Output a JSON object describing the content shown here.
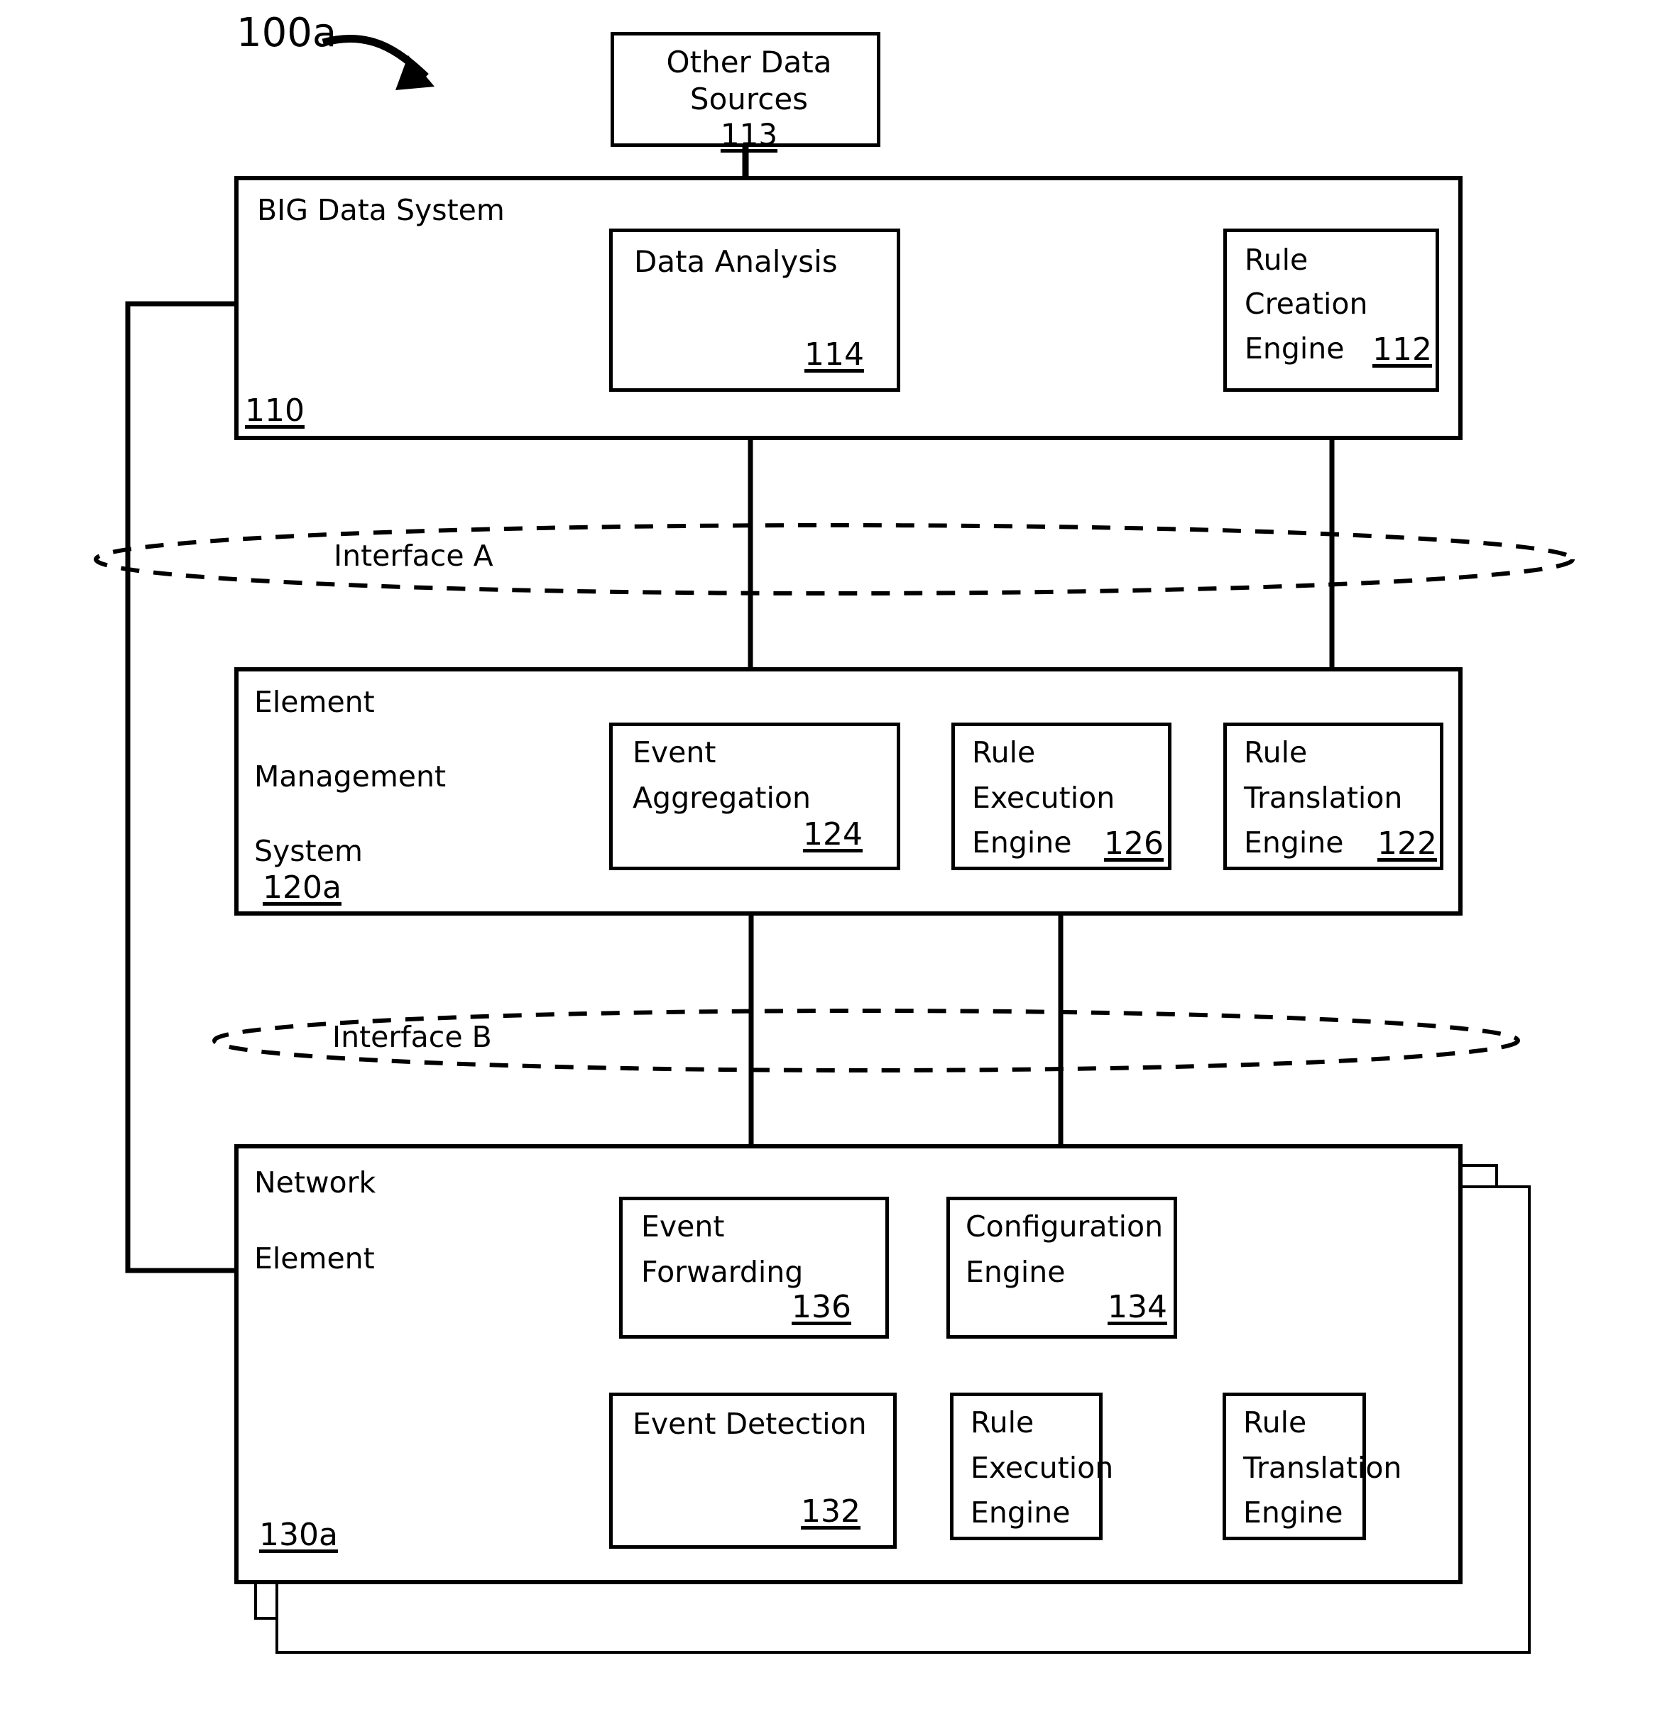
{
  "figure": {
    "id": "100a",
    "title_callout": "100a"
  },
  "nodes": {
    "other_data_sources": {
      "line1": "Other Data",
      "line2": "Sources",
      "ref": "113"
    },
    "big_data_system": {
      "label": "BIG Data System",
      "ref": "110"
    },
    "data_analysis": {
      "line1": "Data Analysis",
      "ref": "114"
    },
    "rule_creation_engine": {
      "line1": "Rule",
      "line2": "Creation",
      "line3": "Engine",
      "ref": "112"
    },
    "interface_a": {
      "label": "Interface A"
    },
    "element_management_system": {
      "line1": "Element",
      "line2": "Management",
      "line3": "System",
      "ref": "120a"
    },
    "event_aggregation": {
      "line1": "Event",
      "line2": "Aggregation",
      "ref": "124"
    },
    "rule_execution_engine_ems": {
      "line1": "Rule",
      "line2": "Execution",
      "line3": "Engine",
      "ref": "126"
    },
    "rule_translation_engine_ems": {
      "line1": "Rule",
      "line2": "Translation",
      "line3": "Engine",
      "ref": "122"
    },
    "interface_b": {
      "label": "Interface B"
    },
    "network_element": {
      "line1": "Network",
      "line2": "Element",
      "ref": "130a"
    },
    "event_forwarding": {
      "line1": "Event",
      "line2": "Forwarding",
      "ref": "136"
    },
    "configuration_engine": {
      "line1": "Configuration",
      "line2": "Engine",
      "ref": "134"
    },
    "event_detection": {
      "line1": "Event Detection",
      "ref": "132"
    },
    "rule_execution_engine_ne": {
      "line1": "Rule",
      "line2": "Execution",
      "line3": "Engine"
    },
    "rule_translation_engine_ne": {
      "line1": "Rule",
      "line2": "Translation",
      "line3": "Engine"
    }
  },
  "colors": {
    "stroke": "#000000",
    "fill": "#ffffff"
  },
  "chart_data": {
    "type": "diagram",
    "title": "100a",
    "containers": [
      {
        "name": "BIG Data System",
        "ref": "110",
        "children": [
          "Data Analysis 114",
          "Rule Creation Engine 112"
        ]
      },
      {
        "name": "Element Management System",
        "ref": "120a",
        "children": [
          "Event Aggregation 124",
          "Rule Execution Engine 126",
          "Rule Translation Engine 122"
        ]
      },
      {
        "name": "Network Element",
        "ref": "130a",
        "children": [
          "Event Forwarding 136",
          "Configuration Engine 134",
          "Event Detection 132",
          "Rule Execution Engine",
          "Rule Translation Engine"
        ]
      }
    ],
    "boundaries": [
      "Interface A",
      "Interface B"
    ],
    "edges": [
      {
        "from": "Other Data Sources 113",
        "to": "Data Analysis 114"
      },
      {
        "from": "Data Analysis 114",
        "to": "Rule Creation Engine 112"
      },
      {
        "from": "Rule Creation Engine 112",
        "to": "Rule Translation Engine 122"
      },
      {
        "from": "Rule Translation Engine 122",
        "to": "Rule Execution Engine 126"
      },
      {
        "from": "Event Aggregation 124",
        "to": "Rule Execution Engine 126"
      },
      {
        "from": "Event Aggregation 124",
        "to": "Data Analysis 114"
      },
      {
        "from": "Rule Execution Engine 126",
        "to": "Configuration Engine 134"
      },
      {
        "from": "Configuration Engine 134",
        "to": "Event Forwarding 136"
      },
      {
        "from": "Event Detection 132",
        "to": "Event Forwarding 136"
      },
      {
        "from": "Event Forwarding 136",
        "to": "Event Aggregation 124"
      },
      {
        "from": "Network Element 130a",
        "to": "Data Analysis 114"
      }
    ]
  }
}
